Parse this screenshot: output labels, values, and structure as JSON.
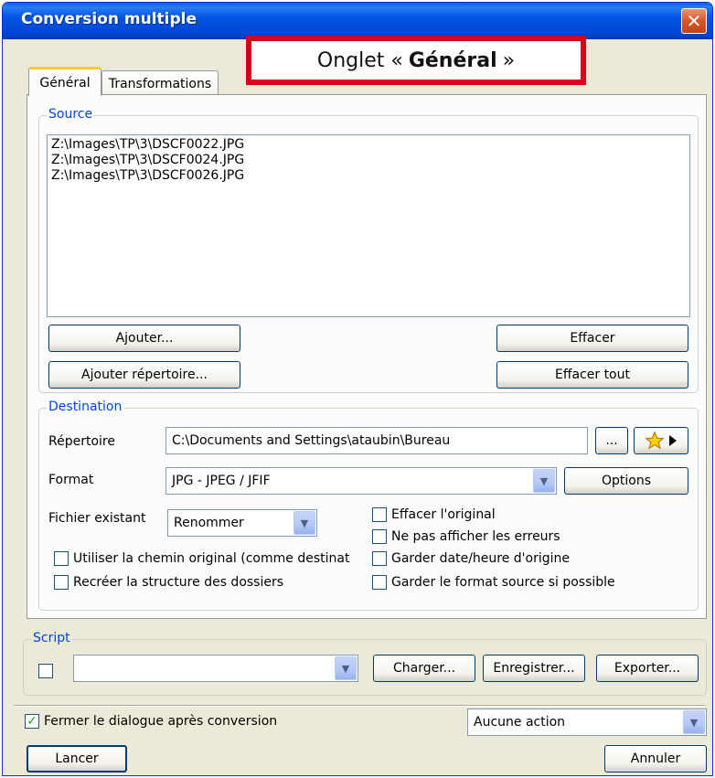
{
  "window": {
    "title": "Conversion multiple",
    "close_symbol": "✕"
  },
  "annotation": {
    "prefix": "Onglet «",
    "bold": "Général",
    "suffix": "»"
  },
  "tabs": [
    {
      "label": "Général",
      "active": true
    },
    {
      "label": "Transformations",
      "active": false
    }
  ],
  "source": {
    "legend": "Source",
    "files": [
      "Z:\\Images\\TP\\3\\DSCF0022.JPG",
      "Z:\\Images\\TP\\3\\DSCF0024.JPG",
      "Z:\\Images\\TP\\3\\DSCF0026.JPG"
    ],
    "add_label": "Ajouter...",
    "add_folder_label": "Ajouter répertoire...",
    "remove_label": "Effacer",
    "remove_all_label": "Effacer tout"
  },
  "destination": {
    "legend": "Destination",
    "folder_label": "Répertoire",
    "folder_value": "C:\\Documents and Settings\\ataubin\\Bureau",
    "browse_label": "...",
    "format_label": "Format",
    "format_value": "JPG - JPEG / JFIF",
    "options_label": "Options",
    "existing_label": "Fichier existant",
    "existing_value": "Renommer",
    "use_orig_path_label": "Utiliser la chemin original (comme destinat",
    "recreate_tree_label": "Recréer la structure des dossiers",
    "delete_orig_label": "Effacer l'original",
    "no_errors_label": "Ne pas afficher les erreurs",
    "keep_date_label": "Garder date/heure d'origine",
    "keep_format_label": "Garder le format source si possible"
  },
  "script": {
    "legend": "Script",
    "combo_value": "",
    "load_label": "Charger...",
    "save_label": "Enregistrer...",
    "export_label": "Exporter..."
  },
  "footer": {
    "close_after_label": "Fermer le dialogue après conversion",
    "close_after_checked": true,
    "action_value": "Aucune action",
    "start_label": "Lancer",
    "cancel_label": "Annuler"
  },
  "colors": {
    "window_bg": "#ECE9D8",
    "titlebar": "#0054E3",
    "legend_text": "#0046D5",
    "annotation_border": "#D6001C"
  }
}
